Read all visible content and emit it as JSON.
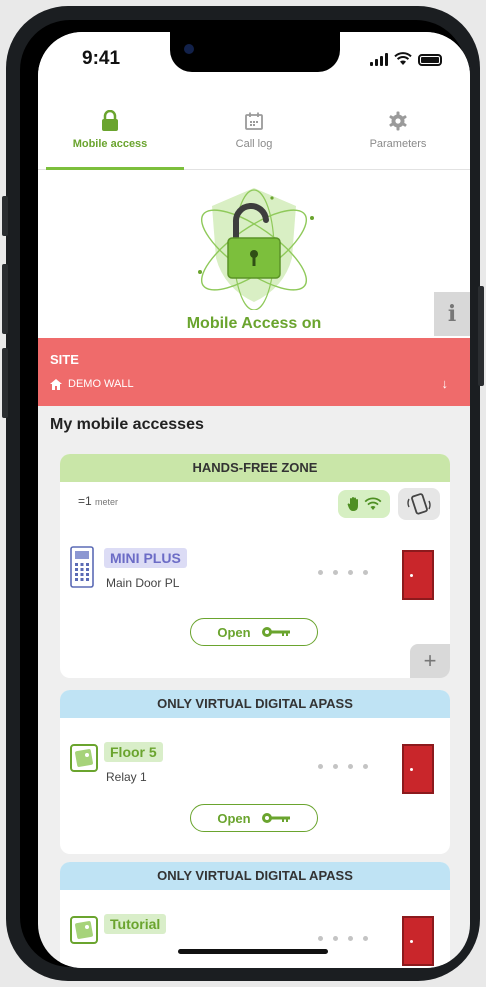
{
  "status_bar": {
    "time": "9:41"
  },
  "tabs": [
    {
      "label": "Mobile access",
      "icon": "lock-icon",
      "active": true
    },
    {
      "label": "Call log",
      "icon": "calendar-icon",
      "active": false
    },
    {
      "label": "Parameters",
      "icon": "gear-icon",
      "active": false
    }
  ],
  "hero": {
    "status": "Mobile Access on",
    "info_label": "i"
  },
  "site": {
    "title": "SITE",
    "name": "DEMO WALL",
    "arrow": "↓"
  },
  "section": {
    "title": "My mobile accesses"
  },
  "cards": [
    {
      "header": "HANDS-FREE ZONE",
      "distance": "=1",
      "distance_unit": "meter",
      "access": {
        "name": "MINI PLUS",
        "sub": "Main Door PL"
      },
      "open_label": "Open",
      "plus_label": "+"
    },
    {
      "header": "ONLY VIRTUAL DIGITAL APASS",
      "access": {
        "name": "Floor 5",
        "sub": "Relay 1"
      },
      "open_label": "Open"
    },
    {
      "header": "ONLY VIRTUAL DIGITAL APASS",
      "access": {
        "name": "Tutorial"
      }
    }
  ],
  "colors": {
    "accent_green": "#6aa42e",
    "site_red": "#ef6b6b",
    "door_red": "#c9262b",
    "zone_blue": "#bfe3f4",
    "zone_green": "#c9e6a8"
  }
}
